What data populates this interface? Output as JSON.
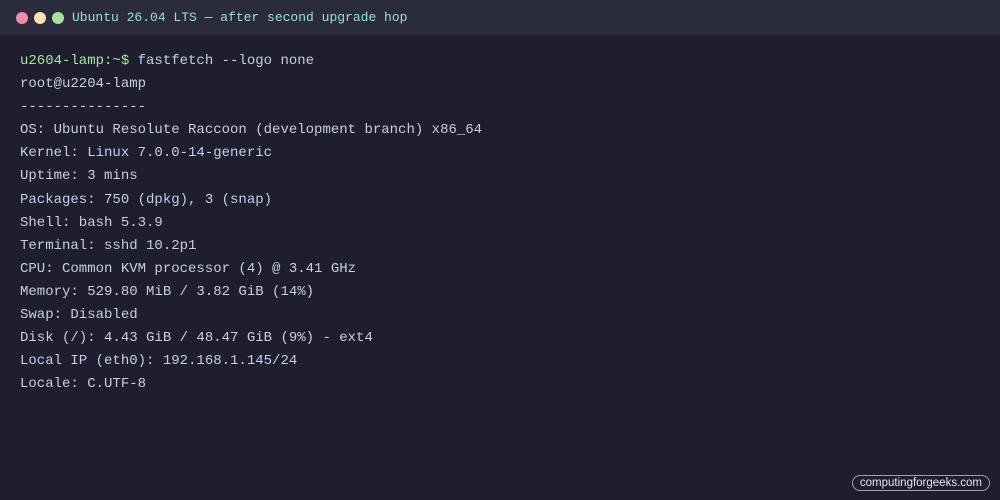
{
  "window": {
    "title": "Ubuntu 26.04 LTS — after second upgrade hop",
    "colors": {
      "close": "#f38ba8",
      "minimize": "#f9e2af",
      "maximize": "#a6e3a1"
    }
  },
  "terminal": {
    "prompt": "u2604-lamp:~$",
    "command": "fastfetch --logo none",
    "output": [
      "root@u2204-lamp",
      "---------------",
      "OS: Ubuntu Resolute Raccoon (development branch) x86_64",
      "Kernel: Linux 7.0.0-14-generic",
      "Uptime: 3 mins",
      "Packages: 750 (dpkg), 3 (snap)",
      "Shell: bash 5.3.9",
      "Terminal: sshd 10.2p1",
      "CPU: Common KVM processor (4) @ 3.41 GHz",
      "Memory: 529.80 MiB / 3.82 GiB (14%)",
      "Swap: Disabled",
      "Disk (/): 4.43 GiB / 48.47 GiB (9%) - ext4",
      "Local IP (eth0): 192.168.1.145/24",
      "Locale: C.UTF-8"
    ]
  },
  "watermark": "computingforgeeks.com"
}
